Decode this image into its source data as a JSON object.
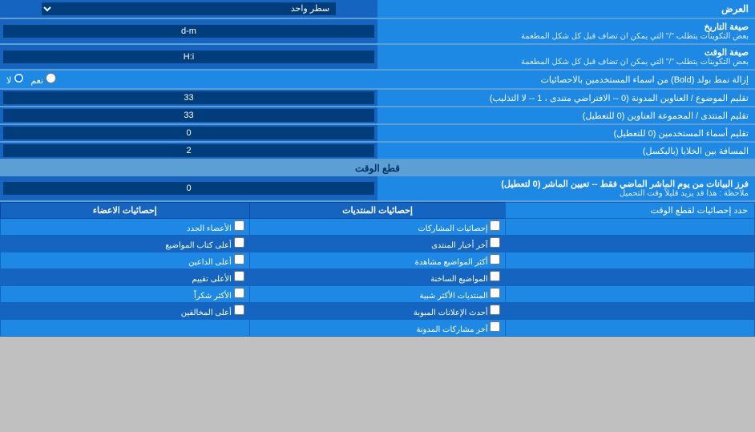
{
  "page": {
    "title": "العرض",
    "dropdown_label": "سطر واحد",
    "date_format_label": "صيغة التاريخ",
    "date_format_hint": "بعض التكوينات يتطلب \"/\" التي يمكن ان تضاف قبل كل شكل المطعمة",
    "date_format_value": "d-m",
    "time_format_label": "صيغة الوقت",
    "time_format_hint": "بعض التكوينات يتطلب \"/\" التي يمكن ان تضاف قبل كل شكل المطعمة",
    "time_format_value": "H:i",
    "bold_label": "إزالة نمط بولد (Bold) من اسماء المستخدمين بالاحصائيات",
    "bold_yes": "نعم",
    "bold_no": "لا",
    "topic_title_label": "تقليم الموضوع / العناوين المدونة (0 -- الافتراضي متندى ، 1 -- لا التذليب)",
    "topic_title_value": "33",
    "forum_title_label": "تقليم المنتدى / المجموعة العناوين (0 للتعطيل)",
    "forum_title_value": "33",
    "username_label": "تقليم أسماء المستخدمين (0 للتعطيل)",
    "username_value": "0",
    "cell_padding_label": "المسافة بين الخلايا (بالبكسل)",
    "cell_padding_value": "2",
    "section_cutoff": "قطع الوقت",
    "cutoff_label": "فرز البيانات من يوم الماشر الماضي فقط -- تعيين الماشر (0 لتعطيل)",
    "cutoff_hint": "ملاحظة : هذا قد يزيد قليلاً وقت التحميل",
    "cutoff_value": "0",
    "limit_label": "حدد إحصائيات لقطع الوقت",
    "stats_posts_header": "إحصائيات المنتديات",
    "stats_members_header": "إحصائيات الاعضاء",
    "stats_items": [
      "إحصائيات المشاركات",
      "آخر أخبار المنتدى",
      "أكثر المواضيع مشاهدة",
      "المواضيع الساخنة",
      "المنتديات الأكثر شبية",
      "أحدث الإعلانات المبوبة",
      "آخر مشاركات المدونة"
    ],
    "members_items": [
      "الأعضاء الجدد",
      "أعلى كتاب المواضيع",
      "أعلى الداعين",
      "الأعلى تقييم",
      "الأكثر شكراً",
      "أعلى المخالفين"
    ]
  }
}
